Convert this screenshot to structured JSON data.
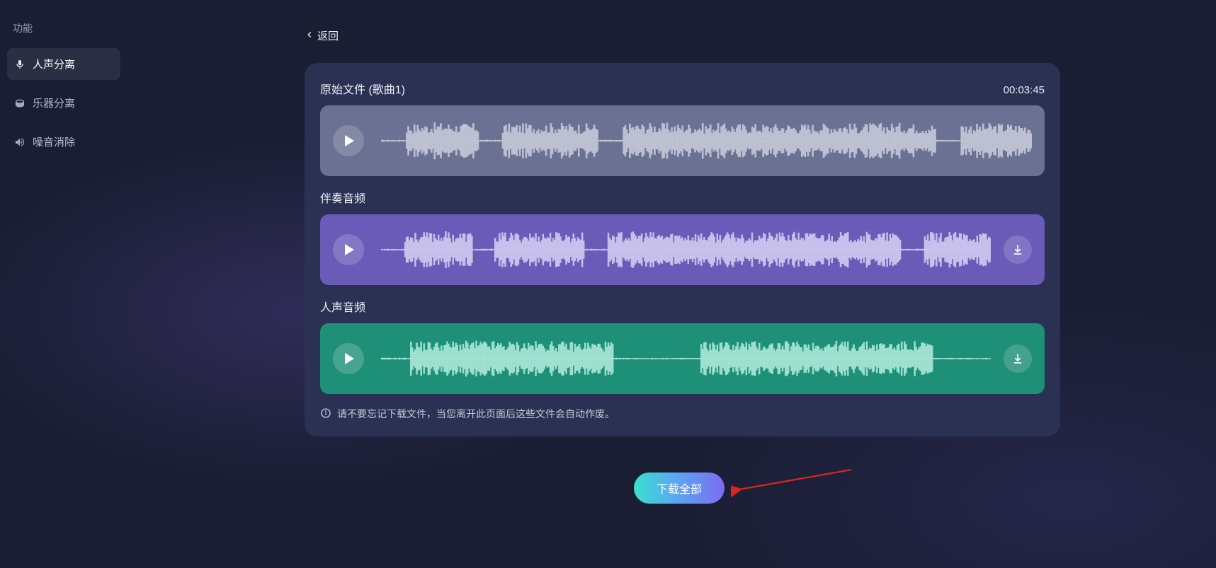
{
  "sidebar": {
    "title": "功能",
    "items": [
      {
        "label": "人声分离",
        "icon": "mic-icon",
        "active": true
      },
      {
        "label": "乐器分离",
        "icon": "drum-icon",
        "active": false
      },
      {
        "label": "噪音消除",
        "icon": "noise-icon",
        "active": false
      }
    ]
  },
  "back_label": "返回",
  "original": {
    "label": "原始文件 (歌曲1)",
    "duration": "00:03:45"
  },
  "tracks": {
    "accomp_label": "伴奏音频",
    "vocal_label": "人声音频"
  },
  "notice": "请不要忘记下载文件，当您离开此页面后这些文件会自动作废。",
  "download_all_label": "下载全部",
  "colors": {
    "card": "#2b3152",
    "original_row": "#6a7193",
    "accomp_row": "#6a5bb8",
    "vocal_row": "#1f9078",
    "button_gradient": [
      "#39e0d0",
      "#5aa8f2",
      "#7a6cf2"
    ]
  }
}
